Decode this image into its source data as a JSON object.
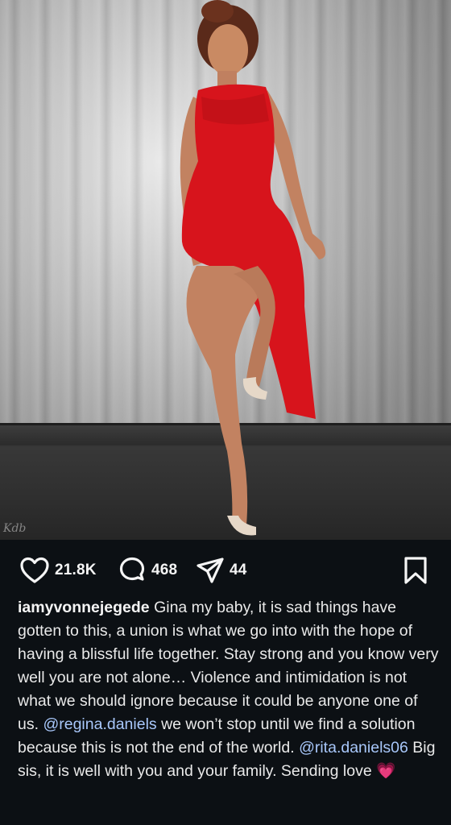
{
  "photo": {
    "watermark": "Kdb",
    "description_icon": "photo-post"
  },
  "actions": {
    "like": {
      "icon": "heart-icon",
      "count": "21.8K"
    },
    "comment": {
      "icon": "comment-icon",
      "count": "468"
    },
    "share": {
      "icon": "send-icon",
      "count": "44"
    },
    "save": {
      "icon": "bookmark-icon"
    }
  },
  "caption": {
    "username": "iamyvonnejegede",
    "text_1": " Gina my baby, it is sad things have gotten to this, a union is what we go into with the hope of having a blissful life together. Stay strong and you know very well you are not alone… Violence and intimidation is not what we should ignore because it could be anyone one of us. ",
    "mention_1": "@regina.daniels",
    "text_2": " we won’t stop until we find a solution because this is not the end of the world. ",
    "mention_2": "@rita.daniels06",
    "text_3": " Big sis, it is well with you and your family. Sending love ",
    "emoji": "💗"
  },
  "colors": {
    "background": "#0c1014",
    "mention": "#a8c7fa",
    "text": "#f5f5f5",
    "dress": "#d7141c"
  }
}
